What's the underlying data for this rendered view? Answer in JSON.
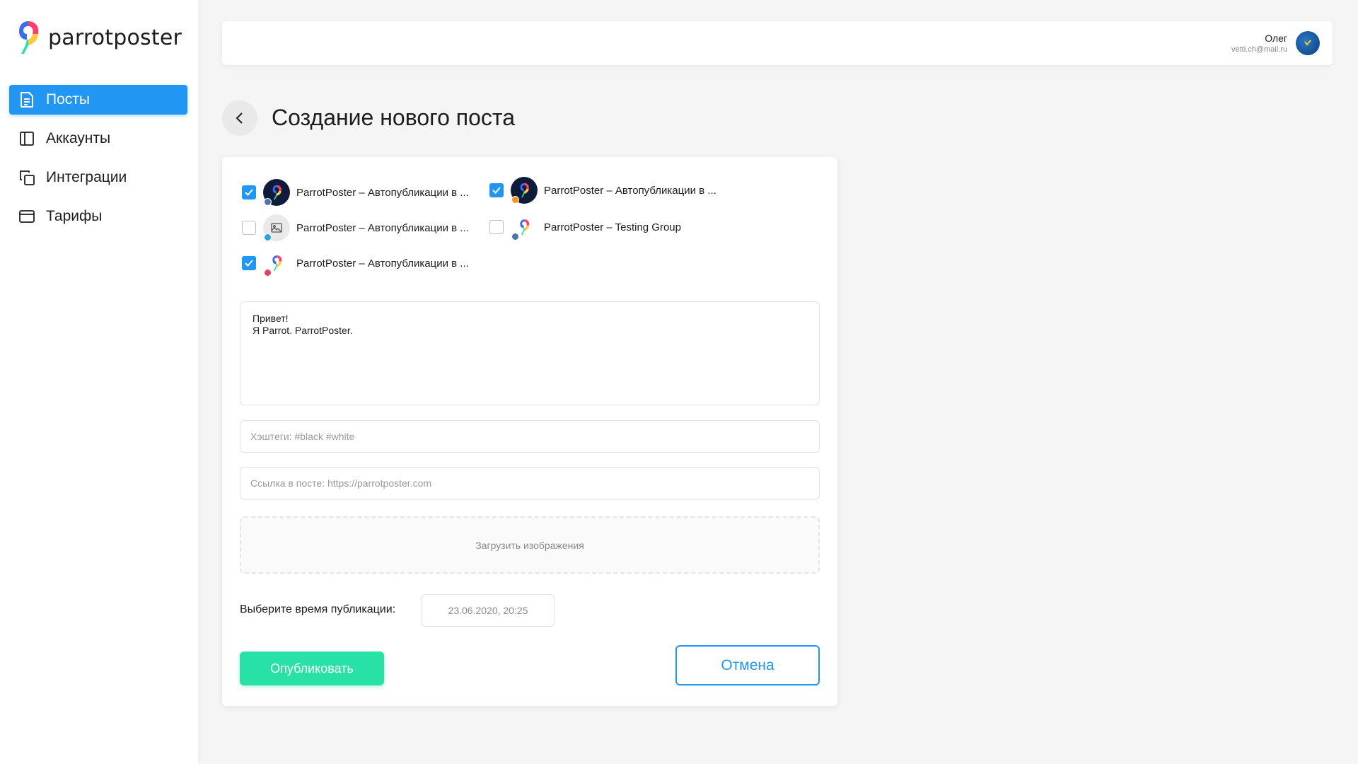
{
  "brand": {
    "name": "parrotposter"
  },
  "sidebar": {
    "items": [
      {
        "label": "Посты",
        "icon": "document-icon",
        "active": true
      },
      {
        "label": "Аккаунты",
        "icon": "panel-icon",
        "active": false
      },
      {
        "label": "Интеграции",
        "icon": "copy-icon",
        "active": false
      },
      {
        "label": "Тарифы",
        "icon": "card-icon",
        "active": false
      }
    ]
  },
  "user": {
    "name": "Олег",
    "email": "vetti.ch@mail.ru"
  },
  "page": {
    "title": "Создание нового поста"
  },
  "accounts": [
    {
      "label": "ParrotPoster – Автопубликации в ...",
      "checked": true,
      "network": "vk"
    },
    {
      "label": "ParrotPoster – Автопубликации в ...",
      "checked": true,
      "network": "ok"
    },
    {
      "label": "ParrotPoster – Автопубликации в ...",
      "checked": false,
      "network": "telegram"
    },
    {
      "label": "ParrotPoster – Testing Group",
      "checked": false,
      "network": "vk"
    },
    {
      "label": "ParrotPoster – Автопубликации в ...",
      "checked": true,
      "network": "instagram"
    }
  ],
  "post": {
    "text": "Привет!\nЯ Parrot. ParrotPoster.",
    "hashtags_placeholder": "Хэштеги: #black #white",
    "link_placeholder": "Ссылка в посте: https://parrotposter.com",
    "upload_label": "Загрузить изображения",
    "time_label": "Выберите время публикации:",
    "time_value": "23.06.2020, 20:25",
    "publish_label": "Опубликовать",
    "cancel_label": "Отмена"
  },
  "colors": {
    "accent": "#2196f3",
    "publish": "#27e1a6",
    "vk": "#4a76a8",
    "ok": "#f7931e",
    "telegram": "#2aa3de",
    "instagram": "#e4405f"
  }
}
